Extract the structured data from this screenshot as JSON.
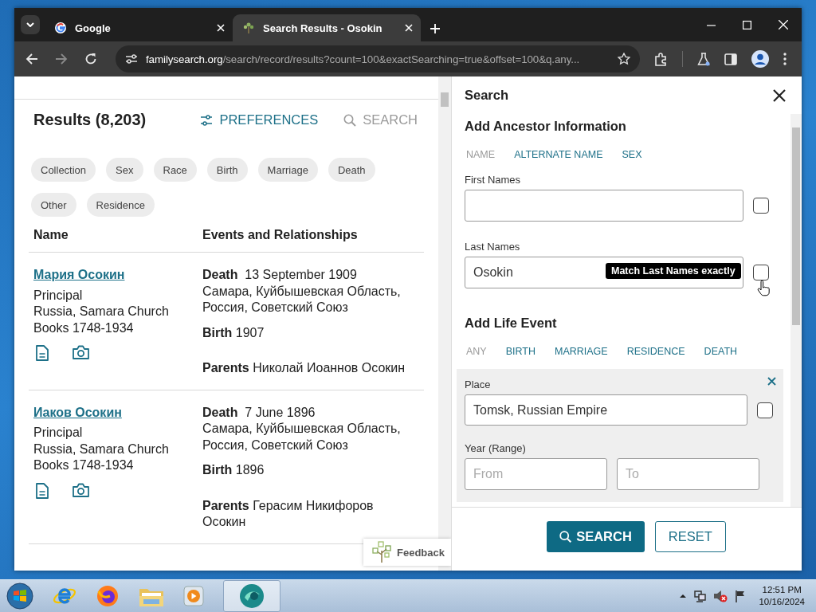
{
  "browser": {
    "tabs": [
      {
        "title": "Google",
        "selected": false,
        "kind": "google"
      },
      {
        "title": "Search Results - Osokin",
        "selected": true,
        "kind": "tree"
      }
    ],
    "address": {
      "domain": "familysearch.org",
      "path": "/search/record/results?count=100&exactSearching=true&offset=100&q.any..."
    }
  },
  "results": {
    "title": "Results (8,203)",
    "preferences": "PREFERENCES",
    "search": "SEARCH",
    "filters": [
      "Collection",
      "Sex",
      "Race",
      "Birth",
      "Marriage",
      "Death",
      "Other",
      "Residence"
    ],
    "columns": [
      "Name",
      "Events and Relationships"
    ],
    "rows": [
      {
        "name": "Мария Осокин",
        "role": "Principal",
        "collection": "Russia, Samara Church Books 1748-1934",
        "events": [
          {
            "label": "Death",
            "value": "13 September 1909",
            "place": "Самара, Куйбышевская Область, Россия, Советский Союз"
          },
          {
            "label": "Birth",
            "value": "1907"
          },
          {
            "label": "Parents",
            "value": "Николай Иоаннов Осокин"
          }
        ]
      },
      {
        "name": "Иаков Осокин",
        "role": "Principal",
        "collection": "Russia, Samara Church Books 1748-1934",
        "events": [
          {
            "label": "Death",
            "value": "7 June 1896",
            "place": "Самара, Куйбышевская Область, Россия, Советский Союз"
          },
          {
            "label": "Birth",
            "value": "1896"
          },
          {
            "label": "Parents",
            "value": "Герасим Никифоров Осокин"
          }
        ]
      }
    ],
    "feedback": "Feedback"
  },
  "search_panel": {
    "title": "Search",
    "ancestor_title": "Add Ancestor Information",
    "ancestor_types": [
      {
        "label": "NAME",
        "disabled": true
      },
      {
        "label": "ALTERNATE NAME",
        "disabled": false
      },
      {
        "label": "SEX",
        "disabled": false
      }
    ],
    "first_names": {
      "label": "First Names",
      "checked": false
    },
    "last_names": {
      "label": "Last Names",
      "value": "Osokin",
      "checked": false,
      "tooltip": "Match Last Names exactly"
    },
    "event_title": "Add Life Event",
    "event_types": [
      {
        "label": "ANY",
        "disabled": true
      },
      {
        "label": "BIRTH",
        "disabled": false
      },
      {
        "label": "MARRIAGE",
        "disabled": false
      },
      {
        "label": "RESIDENCE",
        "disabled": false
      },
      {
        "label": "DEATH",
        "disabled": false
      }
    ],
    "place": {
      "label": "Place",
      "value": "Tomsk, Russian Empire",
      "checked": false
    },
    "year_range": {
      "label": "Year (Range)",
      "from_placeholder": "From",
      "to_placeholder": "To"
    },
    "buttons": [
      {
        "label": "SEARCH",
        "kind": "primary"
      },
      {
        "label": "RESET",
        "kind": "secondary"
      }
    ]
  },
  "taskbar": {
    "time": "12:51 PM",
    "date": "10/16/2024"
  }
}
